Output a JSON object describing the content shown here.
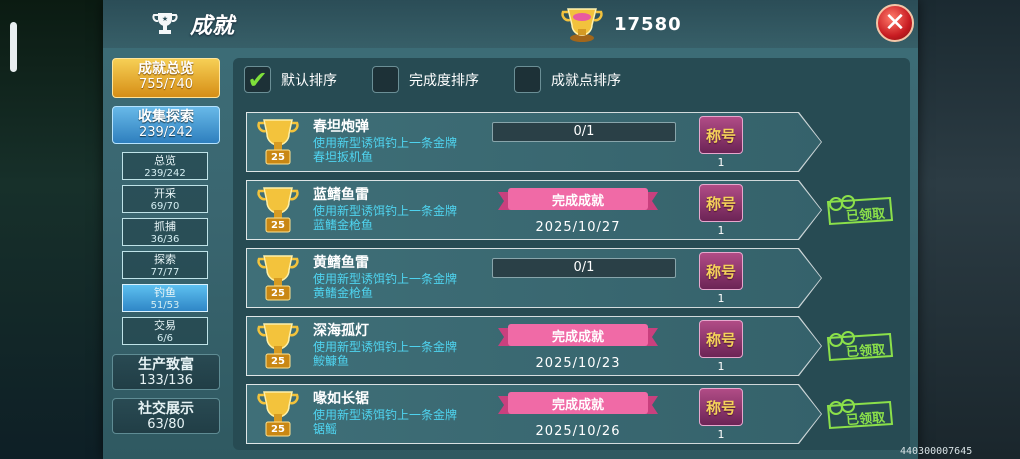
{
  "header": {
    "title": "成就",
    "score": "17580",
    "close_label": "✕"
  },
  "nav": {
    "main": [
      {
        "label": "成就总览",
        "value": "755/740",
        "style": "gold"
      },
      {
        "label": "收集探索",
        "value": "239/242",
        "style": "blue"
      },
      {
        "label": "生产致富",
        "value": "133/136",
        "style": "dark"
      },
      {
        "label": "社交展示",
        "value": "63/80",
        "style": "dark"
      }
    ],
    "sub": [
      {
        "label": "总览",
        "value": "239/242"
      },
      {
        "label": "开采",
        "value": "69/70"
      },
      {
        "label": "抓捕",
        "value": "36/36"
      },
      {
        "label": "探索",
        "value": "77/77"
      },
      {
        "label": "钓鱼",
        "value": "51/53"
      },
      {
        "label": "交易",
        "value": "6/6"
      }
    ]
  },
  "sort": {
    "options": [
      "默认排序",
      "完成度排序",
      "成就点排序"
    ],
    "checked": [
      true,
      false,
      false
    ]
  },
  "achievements": [
    {
      "name": "春坦炮弹",
      "desc1": "使用新型诱饵钓上一条金牌",
      "desc2": "春坦扳机鱼",
      "points": "25",
      "completed": false,
      "progress": "0/1",
      "badge": "称号",
      "count": "1"
    },
    {
      "name": "蓝鳍鱼雷",
      "desc1": "使用新型诱饵钓上一条金牌",
      "desc2": "蓝鳍金枪鱼",
      "points": "25",
      "completed": true,
      "status": "完成成就",
      "date": "2025/10/27",
      "badge": "称号",
      "count": "1",
      "claimed": "已领取"
    },
    {
      "name": "黄鳍鱼雷",
      "desc1": "使用新型诱饵钓上一条金牌",
      "desc2": "黄鳍金枪鱼",
      "points": "25",
      "completed": false,
      "progress": "0/1",
      "badge": "称号",
      "count": "1"
    },
    {
      "name": "深海孤灯",
      "desc1": "使用新型诱饵钓上一条金牌",
      "desc2": "鮟鱇鱼",
      "points": "25",
      "completed": true,
      "status": "完成成就",
      "date": "2025/10/23",
      "badge": "称号",
      "count": "1",
      "claimed": "已领取"
    },
    {
      "name": "喙如长锯",
      "desc1": "使用新型诱饵钓上一条金牌",
      "desc2": "锯鳐",
      "points": "25",
      "completed": true,
      "status": "完成成就",
      "date": "2025/10/26",
      "badge": "称号",
      "count": "1",
      "claimed": "已领取"
    }
  ],
  "footer_id": "440300007645",
  "colors": {
    "accent_gold": "#f6cf55",
    "accent_blue": "#2e7fbe",
    "desc_cyan": "#4fd4f0",
    "claimed_green": "#8be04a"
  }
}
